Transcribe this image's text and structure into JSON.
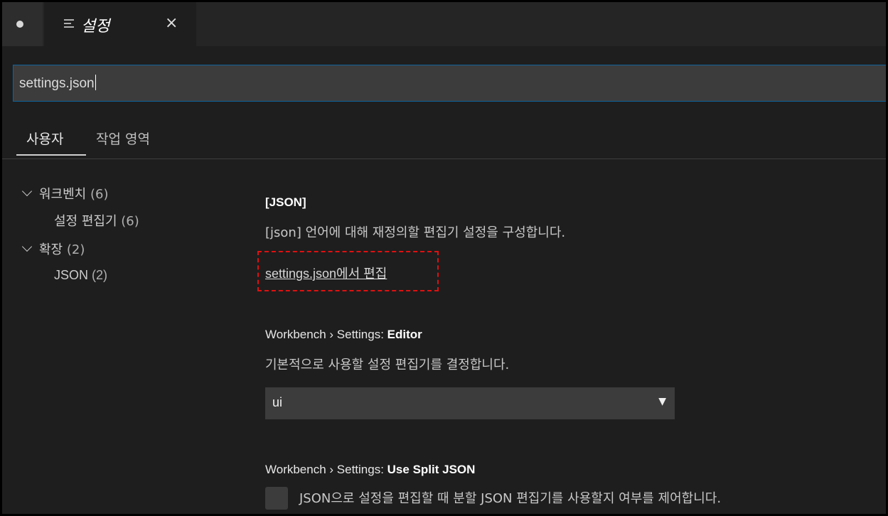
{
  "tab": {
    "title": "설정",
    "close_symbol": "×",
    "icon": "settings-editor-icon"
  },
  "search": {
    "value": "settings.json"
  },
  "scope_tabs": {
    "user": "사용자",
    "workspace": "작업 영역"
  },
  "toc": {
    "items": [
      {
        "label": "워크벤치",
        "count": "(6)",
        "expanded": true
      },
      {
        "label": "설정 편집기",
        "count": "(6)"
      },
      {
        "label": "확장",
        "count": "(2)",
        "expanded": true
      },
      {
        "label": "JSON",
        "count": "(2)"
      }
    ]
  },
  "settings": {
    "json": {
      "title": "[JSON]",
      "description": "[json] 언어에 대해 재정의할 편집기 설정을 구성합니다.",
      "link": "settings.json에서 편집"
    },
    "editor": {
      "category": "Workbench › Settings: ",
      "name": "Editor",
      "description": "기본적으로 사용할 설정 편집기를 결정합니다.",
      "value": "ui",
      "arrow": "▼"
    },
    "split_json": {
      "category": "Workbench › Settings: ",
      "name": "Use Split JSON",
      "description": "JSON으로 설정을 편집할 때 분할 JSON 편집기를 사용할지 여부를 제어합니다.",
      "checked": false
    }
  },
  "colors": {
    "background": "#1e1e1e",
    "highlight": "#e01010",
    "focus_border": "#0e639c"
  }
}
